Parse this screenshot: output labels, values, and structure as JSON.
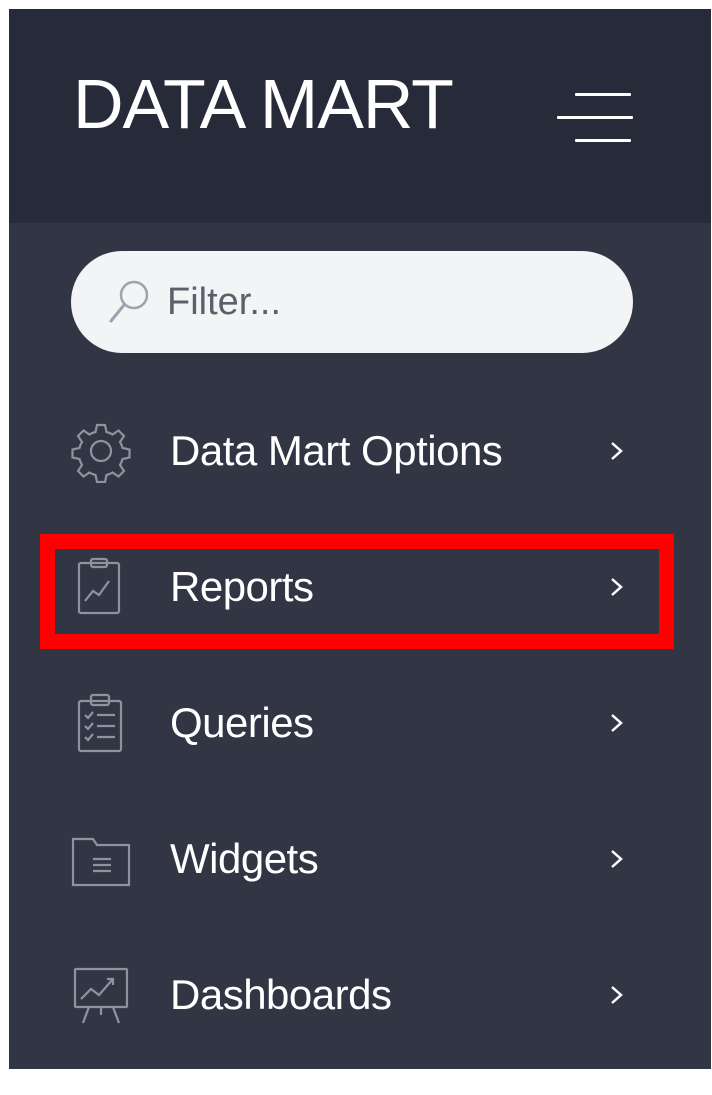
{
  "brand": {
    "title": "DATA MART"
  },
  "search": {
    "placeholder": "Filter..."
  },
  "nav": {
    "items": [
      {
        "label": "Data Mart Options",
        "icon": "gear-icon"
      },
      {
        "label": "Reports",
        "icon": "report-clipboard-icon"
      },
      {
        "label": "Queries",
        "icon": "checklist-clipboard-icon"
      },
      {
        "label": "Widgets",
        "icon": "folder-icon"
      },
      {
        "label": "Dashboards",
        "icon": "presentation-board-icon"
      }
    ]
  },
  "colors": {
    "sidebar_bg": "#323544",
    "header_bg": "#272a38",
    "highlight": "#ff0000",
    "text": "#ffffff",
    "search_bg": "#f3f4f6"
  }
}
